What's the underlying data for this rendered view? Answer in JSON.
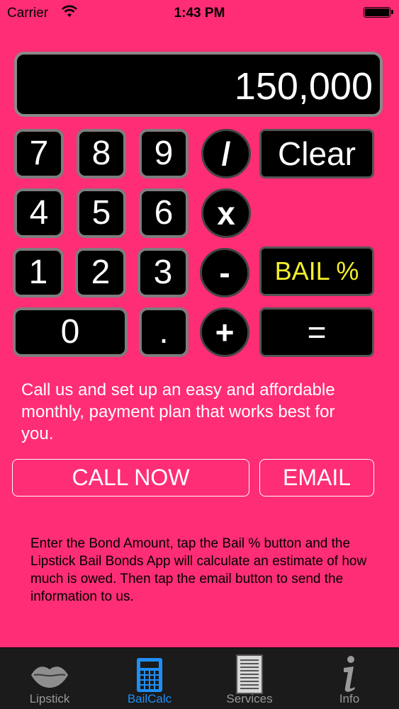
{
  "status_bar": {
    "carrier": "Carrier",
    "time": "1:43 PM"
  },
  "display": {
    "value": "150,000"
  },
  "keys": {
    "k7": "7",
    "k8": "8",
    "k9": "9",
    "divide": "/",
    "clear": "Clear",
    "k4": "4",
    "k5": "5",
    "k6": "6",
    "multiply": "x",
    "k1": "1",
    "k2": "2",
    "k3": "3",
    "minus": "-",
    "bail": "BAIL %",
    "k0": "0",
    "dot": ".",
    "plus": "+",
    "equals": "="
  },
  "promo_text": "Call us and set up an easy and affordable monthly, payment plan that works best for you.",
  "buttons": {
    "call_now": "CALL NOW",
    "email": "EMAIL"
  },
  "instructions": "Enter the Bond Amount, tap the Bail % button and the Lipstick Bail Bonds App will calculate an estimate of how much is owed. Then tap the email button to send the information to us.",
  "tabs": [
    {
      "label": "Lipstick",
      "icon": "lips-icon"
    },
    {
      "label": "BailCalc",
      "icon": "calculator-icon",
      "active": true
    },
    {
      "label": "Services",
      "icon": "document-icon"
    },
    {
      "label": "Info",
      "icon": "info-icon"
    }
  ],
  "colors": {
    "background": "#ff2d75",
    "tab_active": "#1f8ff5",
    "bail_text": "#f3f02a"
  }
}
